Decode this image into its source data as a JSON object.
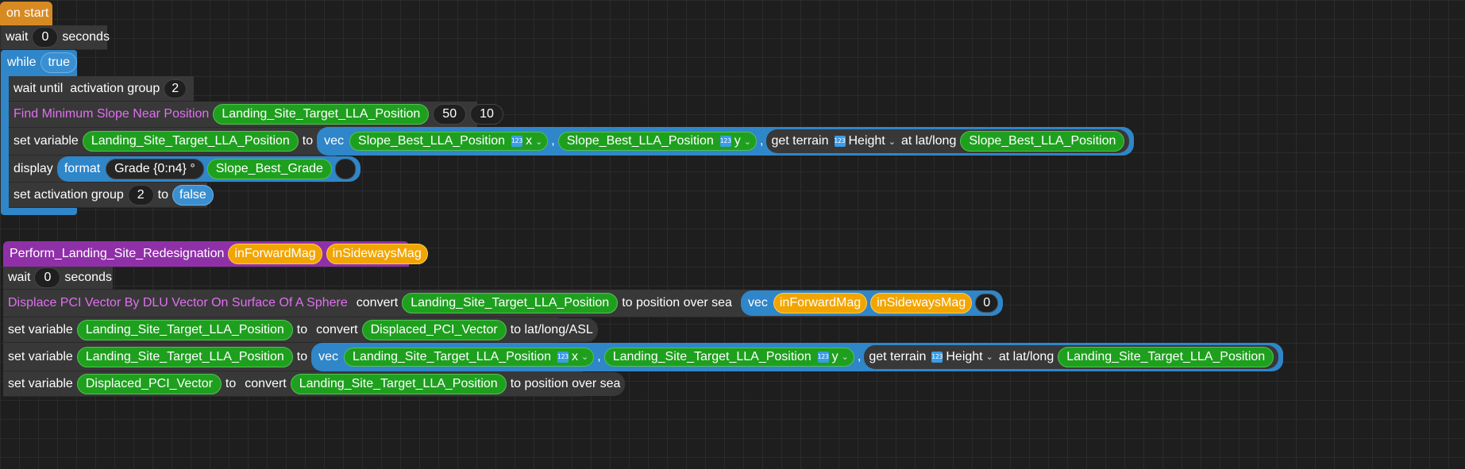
{
  "on_start": {
    "hat_label": "on start",
    "wait": {
      "label": "wait",
      "value": "0",
      "unit": "seconds"
    },
    "while": {
      "label": "while",
      "condition": "true"
    },
    "loop": {
      "wait_until": {
        "label": "wait until",
        "expr": "activation group",
        "value": "2"
      },
      "find_slope": {
        "label": "Find Minimum Slope Near Position",
        "var": "Landing_Site_Target_LLA_Position",
        "arg1": "50",
        "arg2": "10"
      },
      "set_var": {
        "label": "set variable",
        "var": "Landing_Site_Target_LLA_Position",
        "to": "to",
        "vec": "vec",
        "x_var": "Slope_Best_LLA_Position",
        "x_comp": "x",
        "y_var": "Slope_Best_LLA_Position",
        "y_comp": "y",
        "comma": ",",
        "terrain_label": "get terrain",
        "terrain_prop": "Height",
        "at_label": "at lat/long",
        "at_var": "Slope_Best_LLA_Position"
      },
      "display": {
        "label": "display",
        "format": "format",
        "format_str": "Grade {0:n4} °",
        "var": "Slope_Best_Grade"
      },
      "set_group": {
        "label": "set activation group",
        "value": "2",
        "to": "to",
        "state": "false"
      }
    }
  },
  "function": {
    "name": "Perform_Landing_Site_Redesignation",
    "params": [
      "inForwardMag",
      "inSidewaysMag"
    ],
    "wait": {
      "label": "wait",
      "value": "0",
      "unit": "seconds"
    },
    "displace": {
      "label": "Displace PCI Vector By DLU Vector On Surface Of A Sphere",
      "convert": "convert",
      "var": "Landing_Site_Target_LLA_Position",
      "suffix": "to position over sea",
      "vec": "vec",
      "a": "inForwardMag",
      "b": "inSidewaysMag",
      "c": "0"
    },
    "set1": {
      "label": "set variable",
      "var": "Landing_Site_Target_LLA_Position",
      "to": "to",
      "convert": "convert",
      "src": "Displaced_PCI_Vector",
      "suffix": "to lat/long/ASL"
    },
    "set2": {
      "label": "set variable",
      "var": "Landing_Site_Target_LLA_Position",
      "to": "to",
      "vec": "vec",
      "x_var": "Landing_Site_Target_LLA_Position",
      "x_comp": "x",
      "y_var": "Landing_Site_Target_LLA_Position",
      "y_comp": "y",
      "comma": ",",
      "terrain_label": "get terrain",
      "terrain_prop": "Height",
      "at_label": "at lat/long",
      "at_var": "Landing_Site_Target_LLA_Position"
    },
    "set3": {
      "label": "set variable",
      "var": "Displaced_PCI_Vector",
      "to": "to",
      "convert": "convert",
      "src": "Landing_Site_Target_LLA_Position",
      "suffix": "to position over sea"
    }
  },
  "icons": {
    "number_type": "123"
  }
}
